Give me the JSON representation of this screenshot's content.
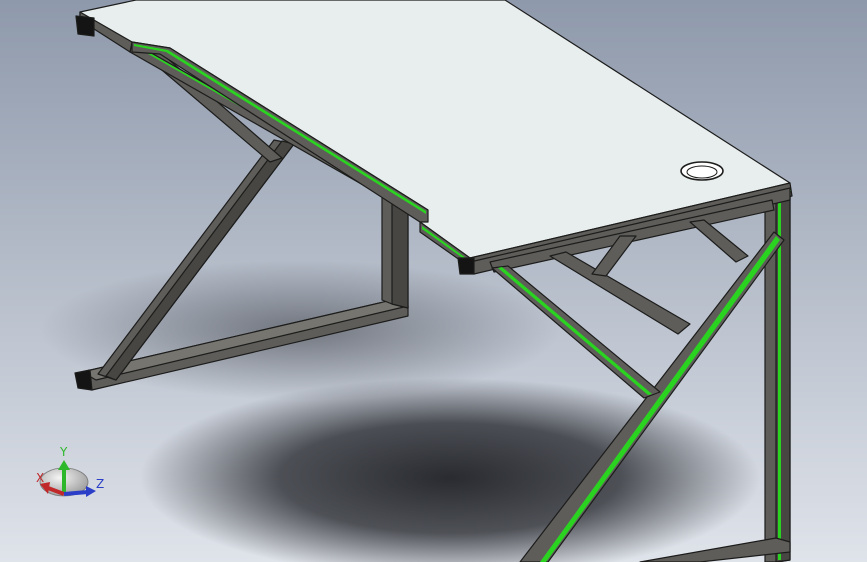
{
  "viewport": {
    "background_colors": {
      "top": "#8e99ab",
      "bottom": "#dfe3ea"
    },
    "shadow_color": "#202227"
  },
  "model": {
    "top_color": "#e8eeee",
    "frame_color": "#5e5d5a",
    "frame_dark_color": "#2f2f2e",
    "edge_highlight_color": "#2bd321"
  },
  "triad": {
    "x_label": "X",
    "y_label": "Y",
    "z_label": "Z",
    "x_color": "#c0282a",
    "y_color": "#2db82b",
    "z_color": "#2a3ec8",
    "icon": "view-orientation-triad-icon"
  }
}
